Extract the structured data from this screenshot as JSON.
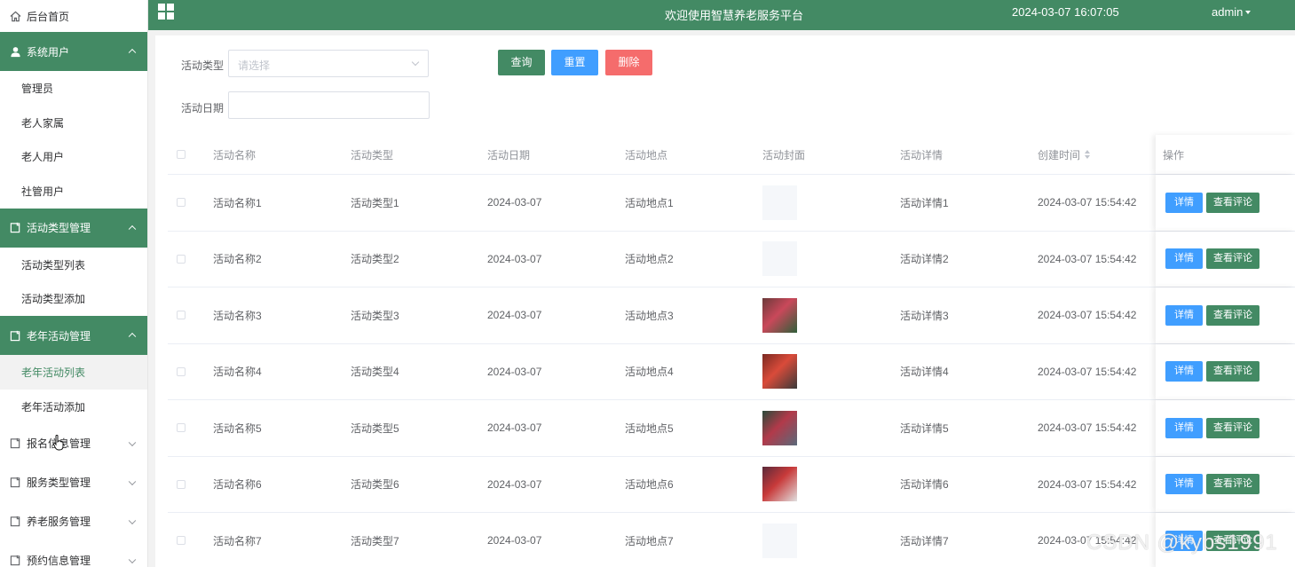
{
  "sidebar": {
    "home_label": "后台首页",
    "groups": [
      {
        "label": "系统用户",
        "items": [
          "管理员",
          "老人家属",
          "老人用户",
          "社管用户"
        ]
      },
      {
        "label": "活动类型管理",
        "items": [
          "活动类型列表",
          "活动类型添加"
        ]
      },
      {
        "label": "老年活动管理",
        "items": [
          "老年活动列表",
          "老年活动添加"
        ]
      },
      {
        "label": "报名信息管理"
      },
      {
        "label": "服务类型管理"
      },
      {
        "label": "养老服务管理"
      },
      {
        "label": "预约信息管理"
      }
    ],
    "active_color": "#438a64"
  },
  "topbar": {
    "welcome": "欢迎使用智慧养老服务平台",
    "datetime": "2024-03-07 16:07:05",
    "user": "admin",
    "color": "#438a64"
  },
  "filters": {
    "type_label": "活动类型",
    "type_placeholder": "请选择",
    "date_label": "活动日期",
    "date_value": "",
    "query_btn": "查询",
    "reset_btn": "重置",
    "delete_btn": "删除"
  },
  "table": {
    "headers": [
      "活动名称",
      "活动类型",
      "活动日期",
      "活动地点",
      "活动封面",
      "活动详情",
      "创建时间",
      "操作"
    ],
    "detail_btn": "详情",
    "comments_btn": "查看评论",
    "rows": [
      {
        "name": "活动名称1",
        "type": "活动类型1",
        "date": "2024-03-07",
        "place": "活动地点1",
        "cover": "placeholder",
        "detail": "活动详情1",
        "created": "2024-03-07 15:54:42"
      },
      {
        "name": "活动名称2",
        "type": "活动类型2",
        "date": "2024-03-07",
        "place": "活动地点2",
        "cover": "placeholder",
        "detail": "活动详情2",
        "created": "2024-03-07 15:54:42"
      },
      {
        "name": "活动名称3",
        "type": "活动类型3",
        "date": "2024-03-07",
        "place": "活动地点3",
        "cover": "photo",
        "detail": "活动详情3",
        "created": "2024-03-07 15:54:42"
      },
      {
        "name": "活动名称4",
        "type": "活动类型4",
        "date": "2024-03-07",
        "place": "活动地点4",
        "cover": "photo",
        "detail": "活动详情4",
        "created": "2024-03-07 15:54:42"
      },
      {
        "name": "活动名称5",
        "type": "活动类型5",
        "date": "2024-03-07",
        "place": "活动地点5",
        "cover": "photo",
        "detail": "活动详情5",
        "created": "2024-03-07 15:54:42"
      },
      {
        "name": "活动名称6",
        "type": "活动类型6",
        "date": "2024-03-07",
        "place": "活动地点6",
        "cover": "photo",
        "detail": "活动详情6",
        "created": "2024-03-07 15:54:42"
      },
      {
        "name": "活动名称7",
        "type": "活动类型7",
        "date": "2024-03-07",
        "place": "活动地点7",
        "cover": "placeholder",
        "detail": "活动详情7",
        "created": "2024-03-07 15:54:42"
      }
    ]
  },
  "watermark": "CSDN @kybs1991"
}
